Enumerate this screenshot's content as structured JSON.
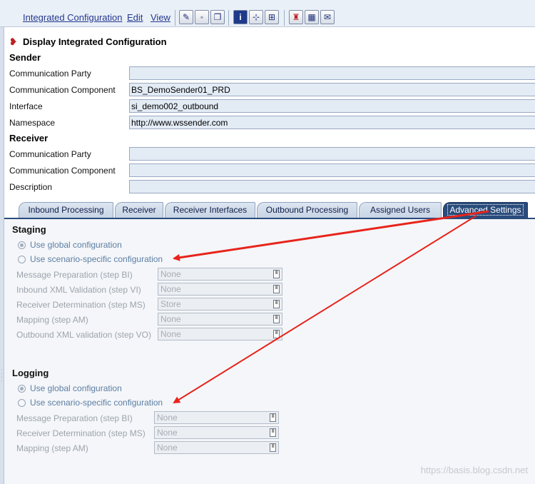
{
  "toolbar": {
    "menu": [
      "Integrated Configuration",
      "Edit",
      "View"
    ]
  },
  "page": {
    "title": "Display Integrated Configuration"
  },
  "sender": {
    "heading": "Sender",
    "fields": [
      {
        "label": "Communication Party",
        "value": ""
      },
      {
        "label": "Communication Component",
        "value": "BS_DemoSender01_PRD"
      },
      {
        "label": "Interface",
        "value": "si_demo002_outbound"
      },
      {
        "label": "Namespace",
        "value": "http://www.wssender.com"
      }
    ]
  },
  "receiver": {
    "heading": "Receiver",
    "fields": [
      {
        "label": "Communication Party",
        "value": ""
      },
      {
        "label": "Communication Component",
        "value": ""
      },
      {
        "label": "Description",
        "value": ""
      }
    ]
  },
  "tabs": [
    {
      "label": "Inbound Processing",
      "active": false
    },
    {
      "label": "Receiver",
      "active": false
    },
    {
      "label": "Receiver Interfaces",
      "active": false
    },
    {
      "label": "Outbound Processing",
      "active": false
    },
    {
      "label": "Assigned Users",
      "active": false
    },
    {
      "label": "Advanced Settings",
      "active": true
    }
  ],
  "staging": {
    "heading": "Staging",
    "options": [
      {
        "label": "Use global configuration",
        "selected": true
      },
      {
        "label": "Use scenario-specific configuration",
        "selected": false
      }
    ],
    "rows": [
      {
        "label": "Message Preparation (step BI)",
        "value": "None"
      },
      {
        "label": "Inbound XML Validation (step VI)",
        "value": "None"
      },
      {
        "label": "Receiver Determination (step MS)",
        "value": "Store"
      },
      {
        "label": "Mapping (step AM)",
        "value": "None"
      },
      {
        "label": "Outbound XML validation (step VO)",
        "value": "None"
      }
    ]
  },
  "logging": {
    "heading": "Logging",
    "options": [
      {
        "label": "Use global configuration",
        "selected": true
      },
      {
        "label": "Use scenario-specific configuration",
        "selected": false
      }
    ],
    "rows": [
      {
        "label": "Message Preparation (step BI)",
        "value": "None"
      },
      {
        "label": "Receiver Determination (step MS)",
        "value": "None"
      },
      {
        "label": "Mapping (step AM)",
        "value": "None"
      }
    ]
  },
  "watermark": "https://basis.blog.csdn.net",
  "colors": {
    "accent": "#2a4c7c",
    "annotation_arrow": "#e8231b"
  },
  "icons": [
    "edit-pencil-icon",
    "save-icon",
    "copy-icon",
    "info-icon",
    "hierarchy-icon",
    "where-used-icon",
    "stamp-icon",
    "table-icon",
    "scroll-icon"
  ]
}
